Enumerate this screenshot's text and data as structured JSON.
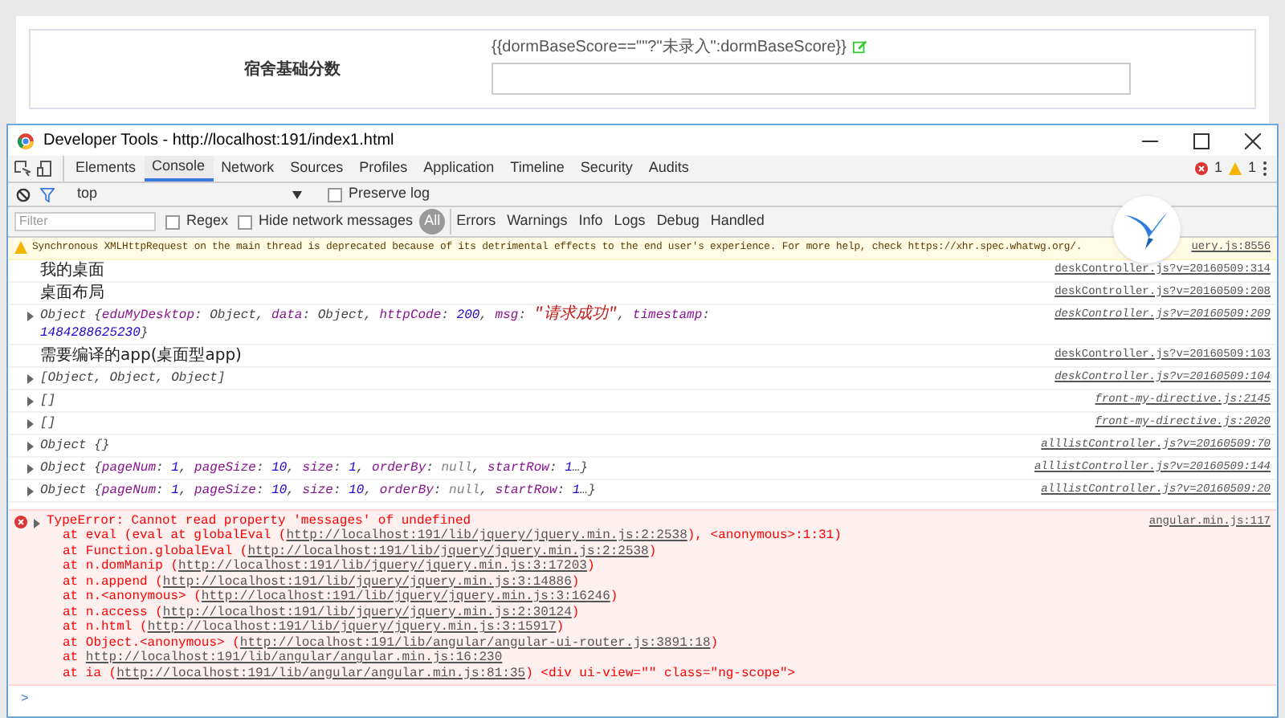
{
  "form": {
    "label": "宿舍基础分数",
    "template": "{{dormBaseScore==\"\"?\"未录入\":dormBaseScore}}"
  },
  "window": {
    "title": "Developer Tools - http://localhost:191/index1.html"
  },
  "tabs": [
    {
      "label": "Elements",
      "selected": false
    },
    {
      "label": "Console",
      "selected": true
    },
    {
      "label": "Network",
      "selected": false
    },
    {
      "label": "Sources",
      "selected": false
    },
    {
      "label": "Profiles",
      "selected": false
    },
    {
      "label": "Application",
      "selected": false
    },
    {
      "label": "Timeline",
      "selected": false
    },
    {
      "label": "Security",
      "selected": false
    },
    {
      "label": "Audits",
      "selected": false
    }
  ],
  "counts": {
    "errors": "1",
    "warnings": "1"
  },
  "context": {
    "value": "top",
    "preserve_log": {
      "label": "Preserve log",
      "checked": false
    }
  },
  "filter_bar": {
    "placeholder": "Filter",
    "regex": {
      "label": "Regex",
      "checked": false
    },
    "hide_network": {
      "label": "Hide network messages",
      "checked": false
    },
    "levels": [
      {
        "label": "All",
        "selected": true
      },
      {
        "label": "Errors",
        "selected": false
      },
      {
        "label": "Warnings",
        "selected": false
      },
      {
        "label": "Info",
        "selected": false
      },
      {
        "label": "Logs",
        "selected": false
      },
      {
        "label": "Debug",
        "selected": false
      },
      {
        "label": "Handled",
        "selected": false
      }
    ]
  },
  "messages": [
    {
      "kind": "warning",
      "text": "Synchronous XMLHttpRequest on the main thread is deprecated because of its detrimental effects to the end user's experience. For more help, check https://xhr.spec.whatwg.org/.",
      "source": "uery.js:8556"
    },
    {
      "kind": "log",
      "text": "我的桌面",
      "source": "deskController.js?v=20160509:314"
    },
    {
      "kind": "log",
      "text": "桌面布局",
      "source": "deskController.js?v=20160509:208"
    },
    {
      "kind": "object",
      "segments": [
        {
          "kind": "plain",
          "text": "Object {"
        },
        {
          "kind": "key",
          "text": "eduMyDesktop"
        },
        {
          "kind": "plain",
          "text": ": Object, "
        },
        {
          "kind": "key",
          "text": "data"
        },
        {
          "kind": "plain",
          "text": ": Object, "
        },
        {
          "kind": "key",
          "text": "httpCode"
        },
        {
          "kind": "plain",
          "text": ": "
        },
        {
          "kind": "num",
          "text": "200"
        },
        {
          "kind": "plain",
          "text": ", "
        },
        {
          "kind": "key",
          "text": "msg"
        },
        {
          "kind": "plain",
          "text": ": "
        },
        {
          "kind": "str",
          "text": "\"请求成功\""
        },
        {
          "kind": "plain",
          "text": ", "
        },
        {
          "kind": "key",
          "text": "timestamp"
        },
        {
          "kind": "plain",
          "text": ": "
        },
        {
          "kind": "num",
          "text": "1484288625230"
        },
        {
          "kind": "plain",
          "text": "}"
        }
      ],
      "source": "deskController.js?v=20160509:209"
    },
    {
      "kind": "log",
      "text": "需要编译的app(桌面型app)",
      "source": "deskController.js?v=20160509:103"
    },
    {
      "kind": "object",
      "segments": [
        {
          "kind": "plain",
          "text": "[Object, Object, Object]"
        }
      ],
      "source": "deskController.js?v=20160509:104"
    },
    {
      "kind": "object",
      "segments": [
        {
          "kind": "plain",
          "text": "[]"
        }
      ],
      "source": "front-my-directive.js:2145"
    },
    {
      "kind": "object",
      "segments": [
        {
          "kind": "plain",
          "text": "[]"
        }
      ],
      "source": "front-my-directive.js:2020"
    },
    {
      "kind": "object",
      "segments": [
        {
          "kind": "plain",
          "text": "Object {}"
        }
      ],
      "source": "alllistController.js?v=20160509:70"
    },
    {
      "kind": "object",
      "segments": [
        {
          "kind": "plain",
          "text": "Object {"
        },
        {
          "kind": "key",
          "text": "pageNum"
        },
        {
          "kind": "plain",
          "text": ": "
        },
        {
          "kind": "num",
          "text": "1"
        },
        {
          "kind": "plain",
          "text": ", "
        },
        {
          "kind": "key",
          "text": "pageSize"
        },
        {
          "kind": "plain",
          "text": ": "
        },
        {
          "kind": "num",
          "text": "10"
        },
        {
          "kind": "plain",
          "text": ", "
        },
        {
          "kind": "key",
          "text": "size"
        },
        {
          "kind": "plain",
          "text": ": "
        },
        {
          "kind": "num",
          "text": "1"
        },
        {
          "kind": "plain",
          "text": ", "
        },
        {
          "kind": "key",
          "text": "orderBy"
        },
        {
          "kind": "plain",
          "text": ": "
        },
        {
          "kind": "null",
          "text": "null"
        },
        {
          "kind": "plain",
          "text": ", "
        },
        {
          "kind": "key",
          "text": "startRow"
        },
        {
          "kind": "plain",
          "text": ": "
        },
        {
          "kind": "num",
          "text": "1"
        },
        {
          "kind": "plain",
          "text": "…}"
        }
      ],
      "source": "alllistController.js?v=20160509:144"
    },
    {
      "kind": "object",
      "segments": [
        {
          "kind": "plain",
          "text": "Object {"
        },
        {
          "kind": "key",
          "text": "pageNum"
        },
        {
          "kind": "plain",
          "text": ": "
        },
        {
          "kind": "num",
          "text": "1"
        },
        {
          "kind": "plain",
          "text": ", "
        },
        {
          "kind": "key",
          "text": "pageSize"
        },
        {
          "kind": "plain",
          "text": ": "
        },
        {
          "kind": "num",
          "text": "10"
        },
        {
          "kind": "plain",
          "text": ", "
        },
        {
          "kind": "key",
          "text": "size"
        },
        {
          "kind": "plain",
          "text": ": "
        },
        {
          "kind": "num",
          "text": "10"
        },
        {
          "kind": "plain",
          "text": ", "
        },
        {
          "kind": "key",
          "text": "orderBy"
        },
        {
          "kind": "plain",
          "text": ": "
        },
        {
          "kind": "null",
          "text": "null"
        },
        {
          "kind": "plain",
          "text": ", "
        },
        {
          "kind": "key",
          "text": "startRow"
        },
        {
          "kind": "plain",
          "text": ": "
        },
        {
          "kind": "num",
          "text": "1"
        },
        {
          "kind": "plain",
          "text": "…}"
        }
      ],
      "source": "alllistController.js?v=20160509:20"
    },
    {
      "kind": "error",
      "text": "TypeError: Cannot read property 'messages' of undefined",
      "source": "angular.min.js:117",
      "stack": [
        [
          {
            "kind": "text",
            "text": "at eval (eval at globalEval ("
          },
          {
            "kind": "link",
            "text": "http://localhost:191/lib/jquery/jquery.min.js:2:2538"
          },
          {
            "kind": "text",
            "text": "), <anonymous>:1:31)"
          }
        ],
        [
          {
            "kind": "text",
            "text": "at Function.globalEval ("
          },
          {
            "kind": "link",
            "text": "http://localhost:191/lib/jquery/jquery.min.js:2:2538"
          },
          {
            "kind": "text",
            "text": ")"
          }
        ],
        [
          {
            "kind": "text",
            "text": "at n.domManip ("
          },
          {
            "kind": "link",
            "text": "http://localhost:191/lib/jquery/jquery.min.js:3:17203"
          },
          {
            "kind": "text",
            "text": ")"
          }
        ],
        [
          {
            "kind": "text",
            "text": "at n.append ("
          },
          {
            "kind": "link",
            "text": "http://localhost:191/lib/jquery/jquery.min.js:3:14886"
          },
          {
            "kind": "text",
            "text": ")"
          }
        ],
        [
          {
            "kind": "text",
            "text": "at n.<anonymous> ("
          },
          {
            "kind": "link",
            "text": "http://localhost:191/lib/jquery/jquery.min.js:3:16246"
          },
          {
            "kind": "text",
            "text": ")"
          }
        ],
        [
          {
            "kind": "text",
            "text": "at n.access ("
          },
          {
            "kind": "link",
            "text": "http://localhost:191/lib/jquery/jquery.min.js:2:30124"
          },
          {
            "kind": "text",
            "text": ")"
          }
        ],
        [
          {
            "kind": "text",
            "text": "at n.html ("
          },
          {
            "kind": "link",
            "text": "http://localhost:191/lib/jquery/jquery.min.js:3:15917"
          },
          {
            "kind": "text",
            "text": ")"
          }
        ],
        [
          {
            "kind": "text",
            "text": "at Object.<anonymous> ("
          },
          {
            "kind": "link",
            "text": "http://localhost:191/lib/angular/angular-ui-router.js:3891:18"
          },
          {
            "kind": "text",
            "text": ")"
          }
        ],
        [
          {
            "kind": "text",
            "text": "at "
          },
          {
            "kind": "link",
            "text": "http://localhost:191/lib/angular/angular.min.js:16:230"
          }
        ],
        [
          {
            "kind": "text",
            "text": "at ia ("
          },
          {
            "kind": "link",
            "text": "http://localhost:191/lib/angular/angular.min.js:81:35"
          },
          {
            "kind": "text",
            "text": ") <div ui-view=\"\" class=\"ng-scope\">"
          }
        ]
      ]
    }
  ],
  "prompt": {
    "symbol": ">"
  }
}
